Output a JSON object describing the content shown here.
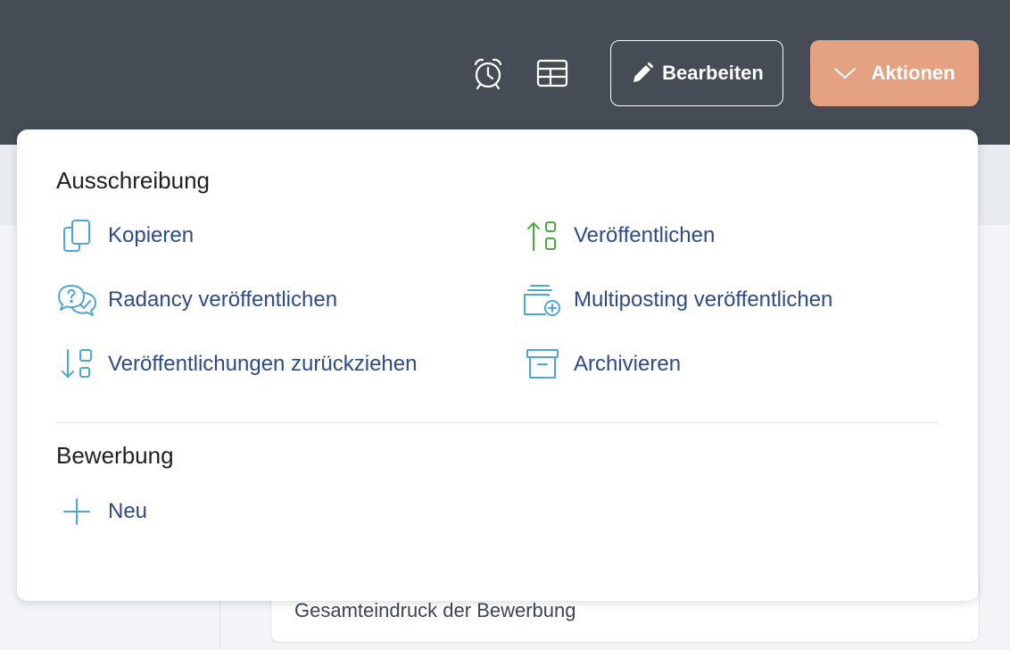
{
  "header": {
    "edit_label": "Bearbeiten",
    "actions_label": "Aktionen",
    "icons": [
      "alarm-clock-icon",
      "table-icon",
      "pencil-icon",
      "chevron-down-icon"
    ]
  },
  "background": {
    "card_title": "Gesamteindruck der Bewerbung"
  },
  "menu": {
    "sections": [
      {
        "title": "Ausschreibung",
        "items": [
          {
            "label": "Kopieren",
            "icon": "copy-icon"
          },
          {
            "label": "Veröffentlichen",
            "icon": "publish-icon"
          },
          {
            "label": "Radancy veröffentlichen",
            "icon": "chat-question-icon"
          },
          {
            "label": "Multiposting veröffentlichen",
            "icon": "multiposting-icon"
          },
          {
            "label": "Veröffentlichungen zurückziehen",
            "icon": "withdraw-icon"
          },
          {
            "label": "Archivieren",
            "icon": "archive-icon"
          }
        ]
      },
      {
        "title": "Bewerbung",
        "items": [
          {
            "label": "Neu",
            "icon": "plus-icon"
          }
        ]
      }
    ]
  },
  "colors": {
    "header_bg": "#454c56",
    "accent": "#e5a283",
    "link_text": "#2e4a8a",
    "icon_blue": "#4ea6d8",
    "icon_green": "#4aaa3e"
  }
}
